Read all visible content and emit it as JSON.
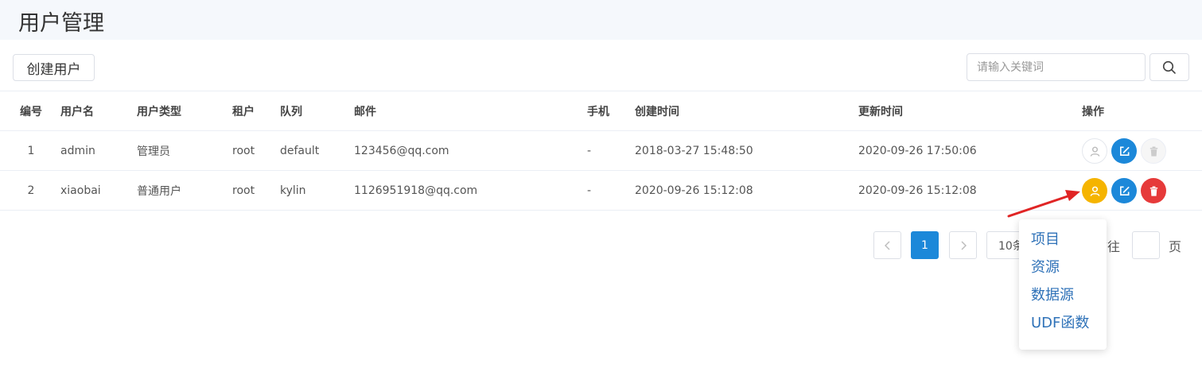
{
  "header": {
    "title": "用户管理"
  },
  "toolbar": {
    "create_label": "创建用户",
    "search_placeholder": "请输入关键词"
  },
  "table": {
    "columns": [
      "编号",
      "用户名",
      "用户类型",
      "租户",
      "队列",
      "邮件",
      "手机",
      "创建时间",
      "更新时间",
      "操作"
    ],
    "rows": [
      {
        "no": "1",
        "username": "admin",
        "type": "管理员",
        "tenant": "root",
        "queue": "default",
        "email": "123456@qq.com",
        "phone": "-",
        "created": "2018-03-27 15:48:50",
        "updated": "2020-09-26 17:50:06"
      },
      {
        "no": "2",
        "username": "xiaobai",
        "type": "普通用户",
        "tenant": "root",
        "queue": "kylin",
        "email": "1126951918@qq.com",
        "phone": "-",
        "created": "2020-09-26 15:12:08",
        "updated": "2020-09-26 15:12:08"
      }
    ]
  },
  "pagination": {
    "current_page": "1",
    "page_size": "10条/页",
    "goto_prefix": "前往",
    "goto_suffix": "页"
  },
  "dropdown": {
    "items": [
      "项目",
      "资源",
      "数据源",
      "UDF函数"
    ]
  },
  "colors": {
    "primary": "#1c88d9",
    "warning": "#f5b400",
    "danger": "#e63a3a",
    "link": "#2f72b8",
    "arrow": "#e02525"
  }
}
